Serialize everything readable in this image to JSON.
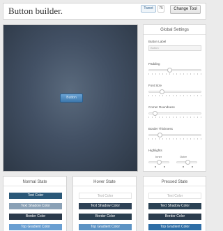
{
  "header": {
    "title": "Button builder.",
    "tweet_label": "Tweet",
    "tweet_count": "75",
    "change_tool": "Change Tool"
  },
  "preview": {
    "button_label": "Button",
    "button_color": "#4a88c0"
  },
  "settings": {
    "title": "Global Settings",
    "button_label": {
      "label": "Button Label",
      "placeholder": "Button"
    },
    "padding": {
      "label": "Padding",
      "value": 0.39
    },
    "font_size": {
      "label": "Font Size",
      "value": 0.23
    },
    "corner_roundness": {
      "label": "Corner Roundness",
      "value": 0.08
    },
    "border_thickness": {
      "label": "Border Thickness",
      "value": 0.18
    },
    "highlights": {
      "label": "Highlights",
      "inner_label": "Inner",
      "outer_label": "Outer",
      "inner_value": 0.5,
      "outer_value": 0.55
    }
  },
  "states": [
    {
      "title": "Normal State",
      "swatches": [
        {
          "label": "Text Color",
          "color": "#2a5878"
        },
        {
          "label": "Text Shadow Color",
          "color": "#8aa1b6"
        },
        {
          "label": "Border Color",
          "color": "#2a3a4b"
        },
        {
          "label": "Top Gradient Color",
          "color": "#6a9fd2"
        }
      ]
    },
    {
      "title": "Hover State",
      "swatches": [
        {
          "label": "Text Color",
          "color": "#ffffff"
        },
        {
          "label": "Text Shadow Color",
          "color": "#2e4256"
        },
        {
          "label": "Border Color",
          "color": "#2a3f50"
        },
        {
          "label": "Top Gradient Color",
          "color": "#5d93c4"
        }
      ]
    },
    {
      "title": "Pressed State",
      "swatches": [
        {
          "label": "Text Color",
          "color": "#ffffff"
        },
        {
          "label": "Text Shadow Color",
          "color": "#2b4254"
        },
        {
          "label": "Border Color",
          "color": "#2b3c4d"
        },
        {
          "label": "Top Gradient Color",
          "color": "#2f6ea6"
        }
      ]
    }
  ]
}
